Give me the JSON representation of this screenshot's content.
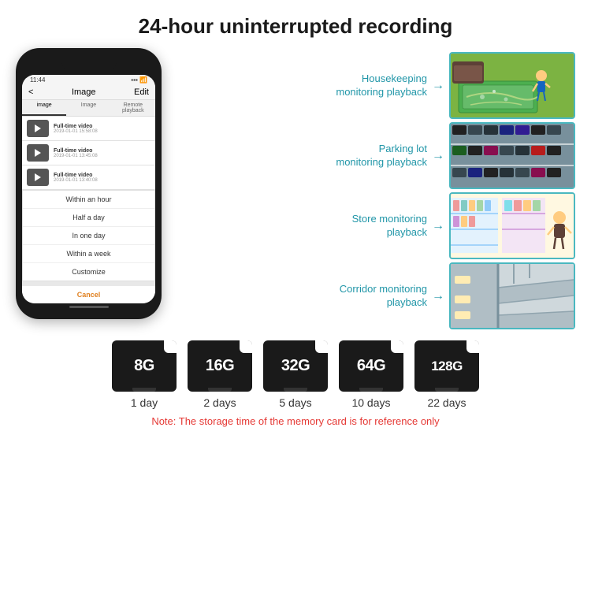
{
  "title": "24-hour uninterrupted recording",
  "phone": {
    "time": "11:44",
    "header_title": "Image",
    "header_edit": "Edit",
    "header_back": "<",
    "tabs": [
      "image",
      "Image",
      "Remote playback"
    ],
    "videos": [
      {
        "title": "Full-time video",
        "date": "2019-01-01 15:58:08"
      },
      {
        "title": "Full-time video",
        "date": "2019-01-01 13:45:08"
      },
      {
        "title": "Full-time video",
        "date": "2019-01-01 13:40:08"
      }
    ],
    "dropdown_items": [
      "Within an hour",
      "Half a day",
      "In one day",
      "Within a week",
      "Customize"
    ],
    "cancel_label": "Cancel"
  },
  "monitoring": [
    {
      "label": "Housekeeping\nmonitoring playback",
      "scene": "housekeeping"
    },
    {
      "label": "Parking lot\nmonitoring playback",
      "scene": "parking"
    },
    {
      "label": "Store monitoring\nplayback",
      "scene": "store"
    },
    {
      "label": "Corridor monitoring\nplayback",
      "scene": "corridor"
    }
  ],
  "sd_cards": [
    {
      "size": "8G",
      "days": "1 day"
    },
    {
      "size": "16G",
      "days": "2 days"
    },
    {
      "size": "32G",
      "days": "5 days"
    },
    {
      "size": "64G",
      "days": "10 days"
    },
    {
      "size": "128G",
      "days": "22 days"
    }
  ],
  "note": "Note: The storage time of the memory card is for reference only"
}
